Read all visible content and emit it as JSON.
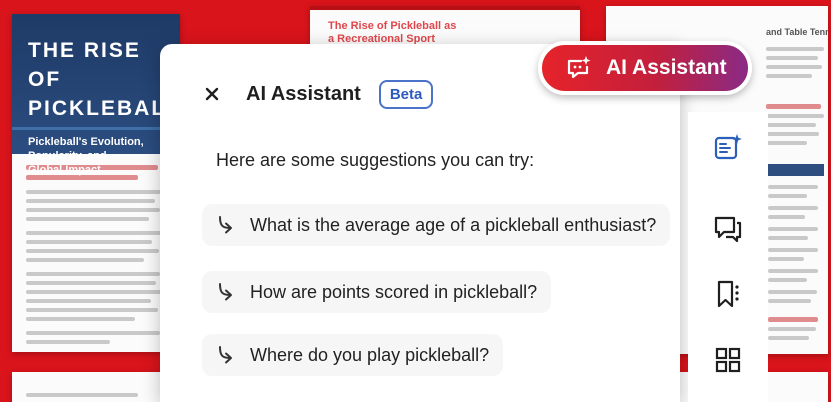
{
  "background_doc": {
    "cover_title": "THE RISE OF\nPICKLEBALL",
    "cover_subtitle": "Pickleball's Evolution,\nPopularity, and\nGlobal Impact",
    "mid_title": "The Rise of Pickleball as\na Recreational Sport",
    "right_partial_title": "and Table Tennis"
  },
  "ai_button": {
    "label": "AI Assistant",
    "icon": "sparkle-chat-icon"
  },
  "panel": {
    "title": "AI Assistant",
    "badge": "Beta",
    "close_icon": "close-icon",
    "intro": "Here are some suggestions you can try:",
    "suggestions": [
      {
        "label": "What is the average age of a pickleball enthusiast?",
        "icon": "arrow-return-icon"
      },
      {
        "label": "How are points scored in pickleball?",
        "icon": "arrow-return-icon"
      },
      {
        "label": "Where do you play pickleball?",
        "icon": "arrow-return-icon"
      }
    ]
  },
  "tool_rail": {
    "items": [
      {
        "icon": "ai-summary-icon"
      },
      {
        "icon": "comment-icon"
      },
      {
        "icon": "bookmark-list-icon"
      },
      {
        "icon": "grid-icon"
      }
    ]
  },
  "colors": {
    "background": "#d9141b",
    "accent_red": "#e6232a",
    "accent_purple": "#8a2a86",
    "badge_blue": "#2c5bbd",
    "cover_navy": "#1e3a66",
    "rail_icon": "#2b5fb8"
  }
}
